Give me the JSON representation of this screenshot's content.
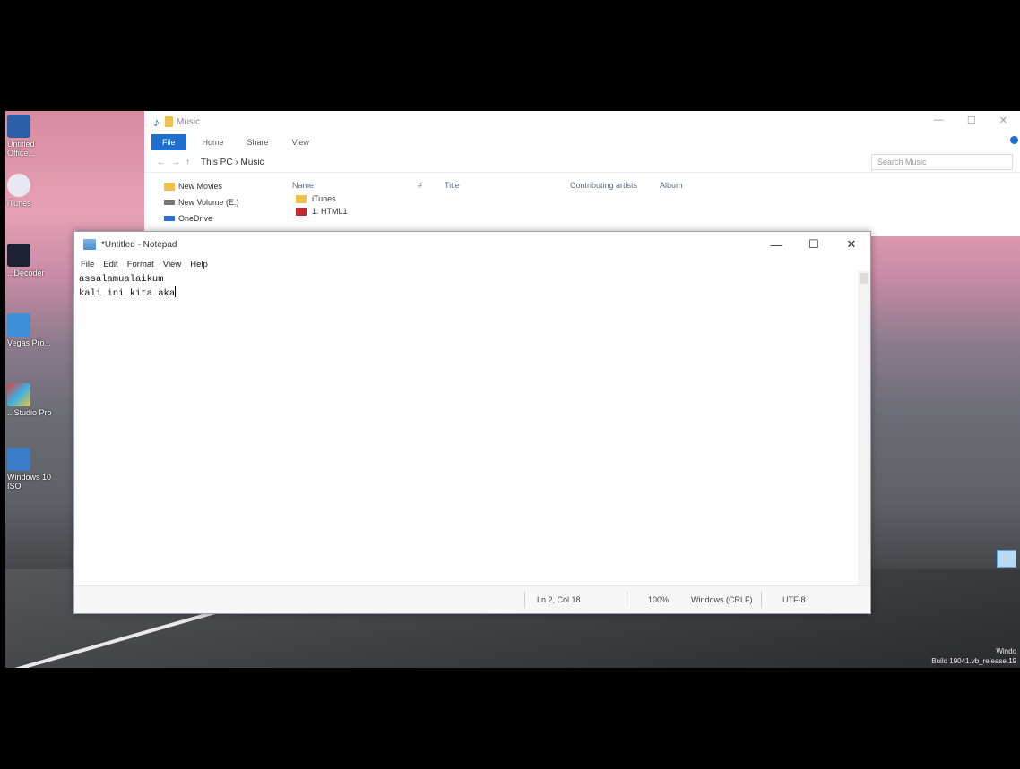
{
  "desktop": {
    "icons": [
      {
        "label": "Untitled Office..."
      },
      {
        "label": "iTunes"
      },
      {
        "label": "...Decoder"
      },
      {
        "label": "Vegas Pro..."
      },
      {
        "label": "...Studio Pro"
      },
      {
        "label": "Windows 10 ISO"
      }
    ],
    "watermark_line1": "Windo",
    "watermark_line2": "Build 19041.vb_release.19"
  },
  "explorer": {
    "title": "Music",
    "tabs": {
      "file": "File",
      "home": "Home",
      "share": "Share",
      "view": "View"
    },
    "path": "This PC  ›  Music",
    "search_placeholder": "Search Music",
    "nav_items": [
      "New Movies",
      "New Volume (E:)",
      "OneDrive"
    ],
    "columns": {
      "name": "Name",
      "num": "#",
      "title": "Title",
      "artists": "Contributing artists",
      "album": "Album"
    },
    "files": [
      "iTunes",
      "1. HTML1"
    ]
  },
  "notepad": {
    "title": "*Untitled - Notepad",
    "menu": {
      "file": "File",
      "edit": "Edit",
      "format": "Format",
      "view": "View",
      "help": "Help"
    },
    "controls": {
      "minimize": "—",
      "maximize": "☐",
      "close": "✕"
    },
    "text_line1": "assalamualaikum",
    "text_line2": "kali ini kita aka",
    "status": {
      "position": "Ln 2, Col 18",
      "zoom": "100%",
      "eol": "Windows (CRLF)",
      "encoding": "UTF-8"
    }
  }
}
